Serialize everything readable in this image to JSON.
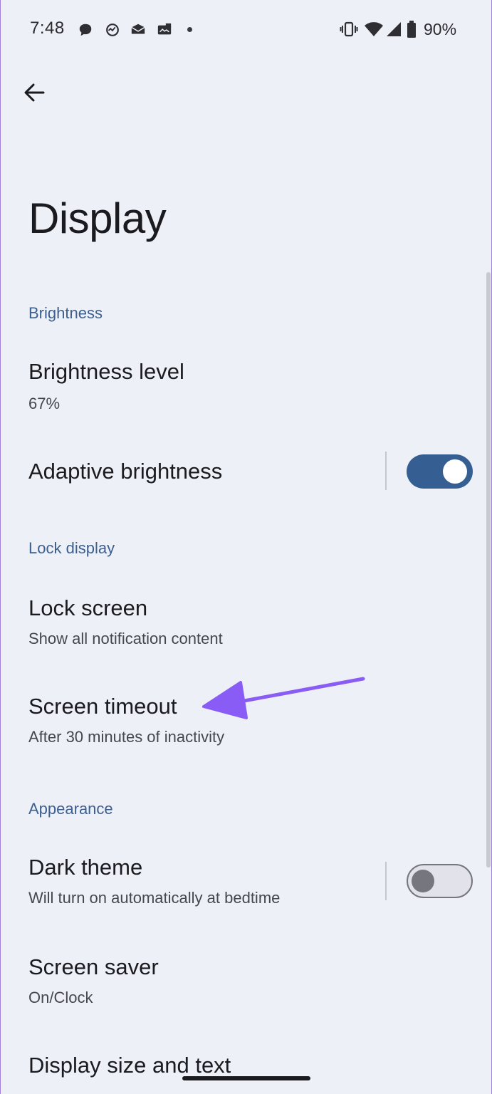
{
  "status_bar": {
    "time": "7:48",
    "battery_percent": "90%",
    "notification_icons": [
      "chat-bubble-icon",
      "sync-activity-icon",
      "mail-envelope-icon",
      "photo-mail-icon"
    ],
    "system_icons": [
      "vibrate-icon",
      "wifi-icon",
      "cell-signal-icon",
      "battery-icon"
    ]
  },
  "page": {
    "title": "Display"
  },
  "sections": {
    "brightness": {
      "header": "Brightness",
      "brightness_level": {
        "title": "Brightness level",
        "value": "67%"
      },
      "adaptive_brightness": {
        "title": "Adaptive brightness",
        "enabled": true
      }
    },
    "lock_display": {
      "header": "Lock display",
      "lock_screen": {
        "title": "Lock screen",
        "subtitle": "Show all notification content"
      },
      "screen_timeout": {
        "title": "Screen timeout",
        "subtitle": "After 30 minutes of inactivity"
      }
    },
    "appearance": {
      "header": "Appearance",
      "dark_theme": {
        "title": "Dark theme",
        "subtitle": "Will turn on automatically at bedtime",
        "enabled": false
      },
      "screen_saver": {
        "title": "Screen saver",
        "subtitle": "On/Clock"
      },
      "display_size": {
        "title": "Display size and text"
      }
    }
  },
  "colors": {
    "background": "#eef0f8",
    "accent": "#355f93",
    "section_header": "#3c5f8f",
    "annotation_arrow": "#8a5cf6"
  }
}
